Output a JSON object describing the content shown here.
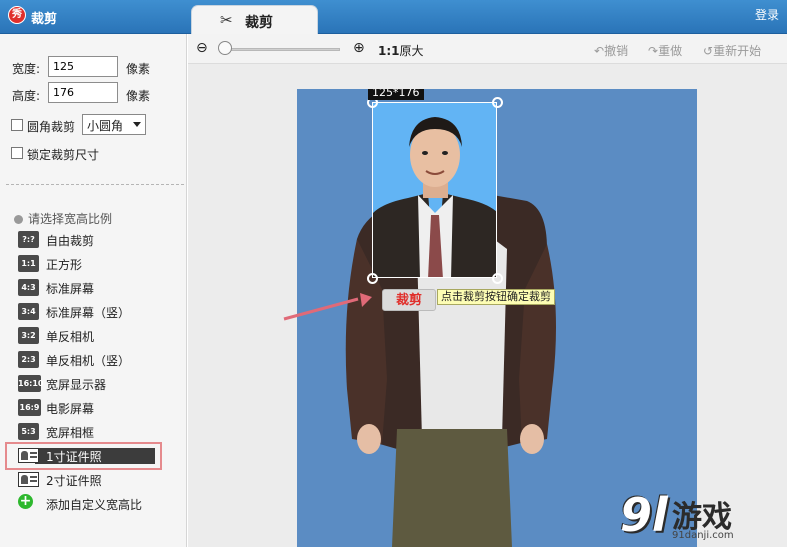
{
  "titlebar": {
    "app_logo": "秀",
    "app_title": "裁剪",
    "tab_label": "裁剪",
    "tab_icon": "scissors-icon",
    "login_label": "登录"
  },
  "left_panel": {
    "width_label": "宽度:",
    "width_value": "125",
    "width_unit": "像素",
    "height_label": "高度:",
    "height_value": "176",
    "height_unit": "像素",
    "rounded_crop_label": "圆角裁剪",
    "rounded_crop_checked": false,
    "corner_select_value": "小圆角",
    "lock_size_label": "锁定裁剪尺寸",
    "lock_size_checked": false,
    "ratio_heading": "请选择宽高比例",
    "ratio_items": [
      {
        "badge": "?:?",
        "label": "自由裁剪"
      },
      {
        "badge": "1:1",
        "label": "正方形"
      },
      {
        "badge": "4:3",
        "label": "标准屏幕"
      },
      {
        "badge": "3:4",
        "label": "标准屏幕（竖）"
      },
      {
        "badge": "3:2",
        "label": "单反相机"
      },
      {
        "badge": "2:3",
        "label": "单反相机（竖）"
      },
      {
        "badge": "16:10",
        "label": "宽屏显示器"
      },
      {
        "badge": "16:9",
        "label": "电影屏幕"
      },
      {
        "badge": "5:3",
        "label": "宽屏相框"
      }
    ],
    "id_photo_items": [
      {
        "label": "1寸证件照",
        "selected": true
      },
      {
        "label": "2寸证件照",
        "selected": false
      }
    ],
    "add_custom_label": "添加自定义宽高比"
  },
  "toolbar": {
    "zoom_level_percent": 0,
    "actual_size_ratio": "1:1",
    "actual_size_label": "原大",
    "undo_label": "撤销",
    "redo_label": "重做",
    "restart_label": "重新开始"
  },
  "canvas": {
    "crop_size_label": "125*176",
    "crop_button_label": "裁剪",
    "crop_tip": "点击裁剪按钮确定裁剪",
    "photo_background": "#5b8cc3",
    "crop_highlight": "#62b4f4"
  },
  "watermark": {
    "logo": "9l",
    "text": "游戏",
    "url": "91danji.com"
  }
}
